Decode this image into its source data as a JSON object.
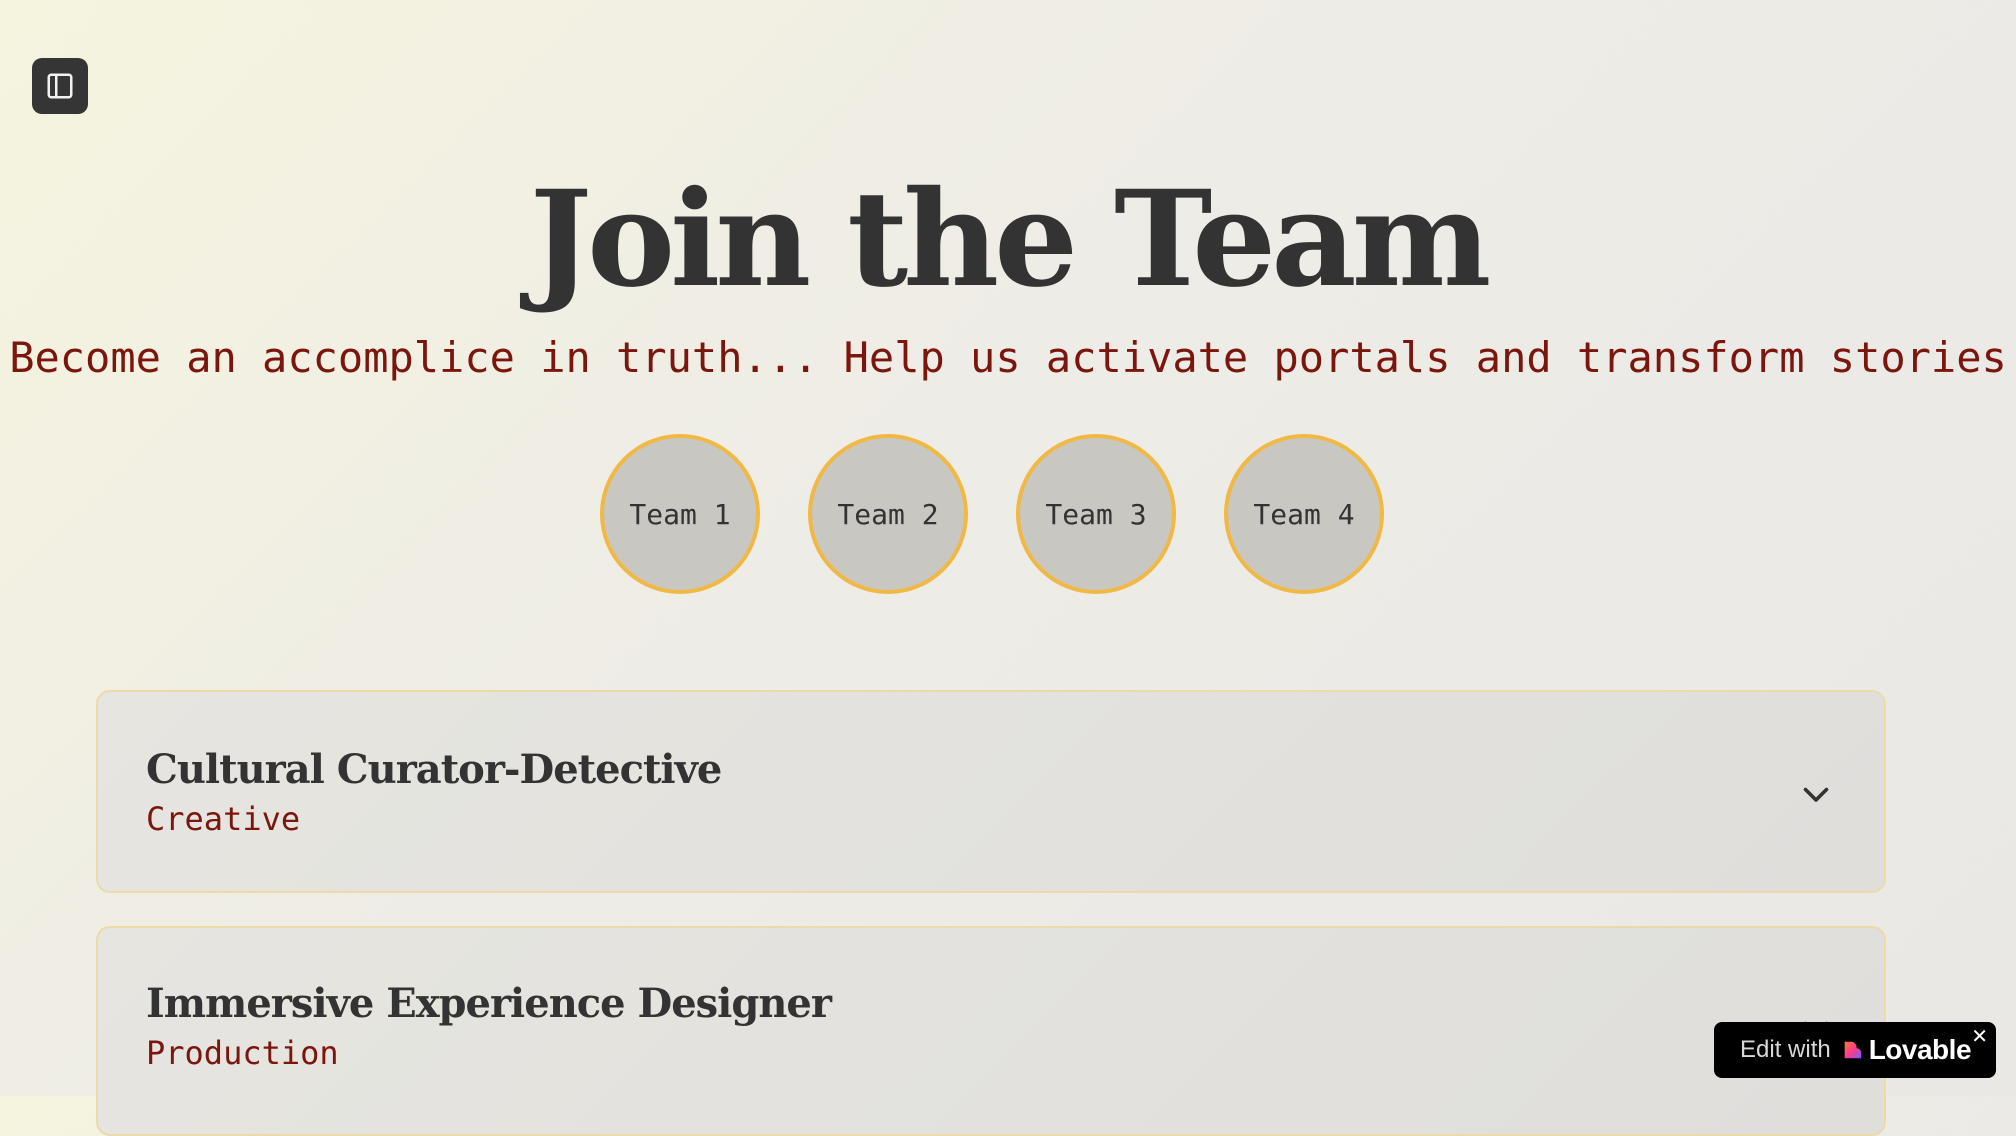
{
  "sidebar_toggle": {
    "icon": "panel-left-icon"
  },
  "hero": {
    "title": "Join the Team",
    "subtitle": "Become an accomplice in truth... Help us activate portals and transform stories"
  },
  "teams": [
    {
      "label": "Team 1"
    },
    {
      "label": "Team 2"
    },
    {
      "label": "Team 3"
    },
    {
      "label": "Team 4"
    }
  ],
  "roles": [
    {
      "title": "Cultural Curator-Detective",
      "department": "Creative"
    },
    {
      "title": "Immersive Experience Designer",
      "department": "Production"
    }
  ],
  "badge": {
    "prefix": "Edit with",
    "brand": "Lovable",
    "close": "✕"
  },
  "colors": {
    "accent_red": "#7a160d",
    "team_border": "#f0b945",
    "text_dark": "#333333"
  }
}
